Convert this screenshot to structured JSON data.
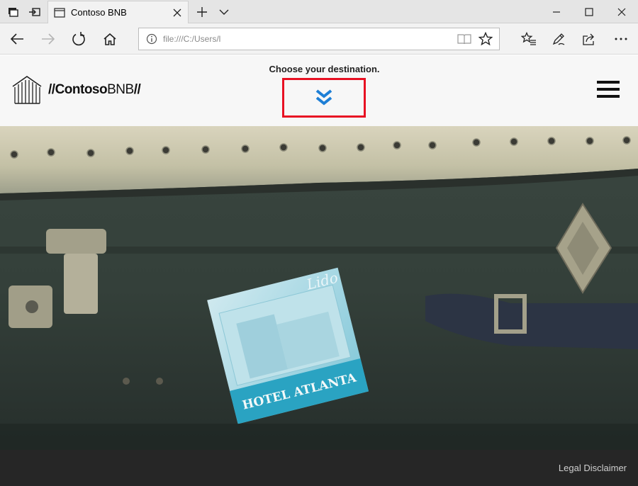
{
  "browser": {
    "tab_title": "Contoso BNB",
    "address": "file:///C:/Users/l",
    "icons": [
      "tab-manager-icon",
      "set-aside-tabs-icon",
      "page-icon",
      "close-icon",
      "new-tab-icon",
      "chevron-down-icon",
      "minimize-icon",
      "maximize-icon",
      "close-window-icon",
      "back-icon",
      "forward-icon",
      "refresh-icon",
      "home-icon",
      "info-icon",
      "reading-view-icon",
      "favorite-star-icon",
      "favorites-hub-icon",
      "pen-icon",
      "share-icon",
      "more-icon"
    ]
  },
  "site": {
    "logo_prefix": "//",
    "logo_bold": "Contoso",
    "logo_thin": "BNB",
    "logo_suffix": "//",
    "prompt": "Choose your destination.",
    "sticker_line1": "Lido",
    "sticker_line2": "HOTEL ATLANTA",
    "footer_link": "Legal Disclaimer"
  },
  "colors": {
    "accent_blue": "#1e7fd6",
    "highlight_red": "#e81123",
    "footer_bg": "#262626",
    "header_bg": "#f7f7f7"
  }
}
